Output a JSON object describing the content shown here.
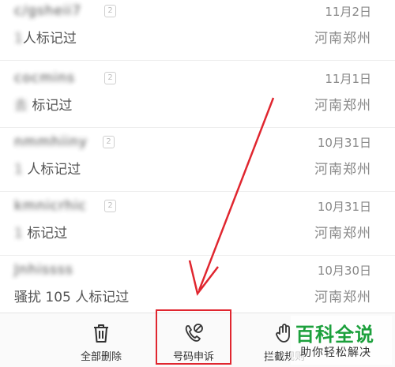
{
  "calls": [
    {
      "name": "c/gsheii7",
      "note_blur": "1",
      "note_text": "人标记过",
      "date": "11月2日",
      "location": "河南郑州"
    },
    {
      "name": "cocmins",
      "note_blur": "去  ",
      "note_text": "标记过",
      "date": "11月1日",
      "location": "河南郑州"
    },
    {
      "name": "nmmhiiny",
      "note_blur": "1  ",
      "note_text": "人标记过",
      "date": "10月31日",
      "location": "河南郑州"
    },
    {
      "name": "kmnicrhic",
      "note_blur": "1  ",
      "note_text": "标记过",
      "date": "10月31日",
      "location": "河南郑州"
    },
    {
      "name": "Jnhissss",
      "note_blur": "",
      "note_text": "骚扰  105 人标记过",
      "date": "10月30日",
      "location": "河南郑州"
    }
  ],
  "badge_glyph": "2",
  "toolbar": {
    "delete_all": "全部删除",
    "number_appeal": "号码申诉",
    "block_rules": "拦截规则"
  },
  "watermark": {
    "title": "百科全说",
    "subtitle": "助你轻松解决"
  },
  "colors": {
    "highlight": "#e0262f",
    "watermark": "#1ca03c"
  }
}
